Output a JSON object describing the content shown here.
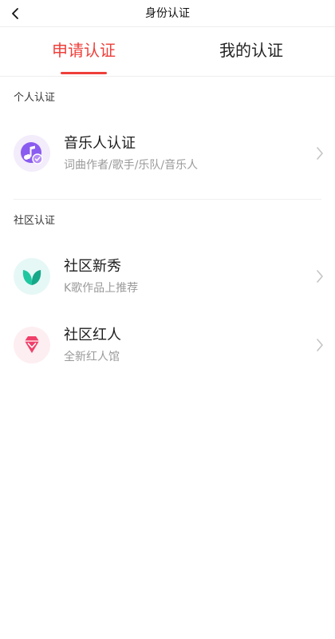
{
  "nav": {
    "title": "身份认证",
    "back_icon": "chevron-left-icon"
  },
  "tabs": [
    {
      "label": "申请认证",
      "active": true
    },
    {
      "label": "我的认证",
      "active": false
    }
  ],
  "colors": {
    "accent": "#ee3f3a",
    "musician_icon_bg": "#f3ecfb",
    "musician_icon_fg": "#8a5cf0",
    "newcomer_icon_bg": "#e6f8f6",
    "newcomer_icon_fg": "#1fc7a0",
    "influencer_icon_bg": "#fdeef1",
    "influencer_icon_fg": "#f0406a"
  },
  "sections": [
    {
      "title": "个人认证",
      "items": [
        {
          "title": "音乐人认证",
          "subtitle": "词曲作者/歌手/乐队/音乐人",
          "icon": "music-note-badge-icon"
        }
      ]
    },
    {
      "title": "社区认证",
      "items": [
        {
          "title": "社区新秀",
          "subtitle": "K歌作品上推荐",
          "icon": "leaf-sprout-icon"
        },
        {
          "title": "社区红人",
          "subtitle": "全新红人馆",
          "icon": "diamond-icon"
        }
      ]
    }
  ]
}
